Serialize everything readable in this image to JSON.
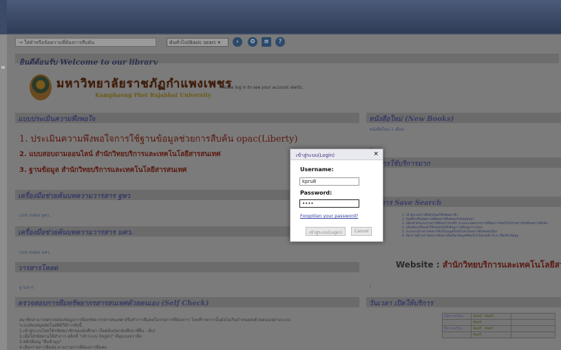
{
  "toolbar": {
    "search_placeholder": "ใส่คำหรือข้อความที่ต้องการสืบค้น",
    "search_type": "ค้นทั่วไป(Basic searc",
    "icons": [
      "go-icon",
      "advanced-search-icon",
      "list-icon",
      "help-icon"
    ]
  },
  "welcome": "ยินดีต้อนรับ Welcome to our library",
  "university": {
    "name_th": "มหาวิทยาลัยราชภัฏกำแพงเพชร",
    "name_en": "Kamphaeng Phet Rajabhat University"
  },
  "login_note": "Please log in to see your account alerts.",
  "left": {
    "survey_title": "แบบประเมินความพึงพอใจ",
    "survey_items": [
      "1. ประเมินความพึงพอใจการใช้ฐานข้อมูลช่วยการสืบค้น opac(Liberty)",
      "2. แบบสอบถามออนไลน์ สำนักวิทยบริการและเทคโนโลยีสารสนเทศ",
      "3. ฐานข้อมูล สำนักวิทยบริการและเทคโนโลยีสารสนเทศ"
    ],
    "tool1_title": "เครื่องมือช่วยค้นบทความวารสาร ฐพว",
    "tool1_link": "Link Index ฐพว.",
    "tool2_title": "เครื่องมือช่วยค้นบทความวารสาร มศว.",
    "tool2_link": "Link Index มศว.",
    "journal_title": "วารสารโหลด",
    "journal_link": "ฐานสาร",
    "selfcheck_title": "ตรวจสอบการยืมทรัพยากรสารสนเทศด้วยตนเอง (Self Check)",
    "selfcheck_lines": [
      "สมาชิกสามารถตรวจสอบข้อมูลการยืมทรัพยากรสารสนเทศ หรือทำการยืมต่อในรายการที่ต้องการ โดยที่รายการนั้นยังไม่เกินกำหนดส่งด้วยตนเองผ่านระบบ",
      "ระบบห้องสมุดอัตโนมัติมีวิธีการดังนี้",
      "1.เข้าสู่ระบบโดยใช้รหัสสมาชิกของนักศึกษา (ล็อคอินบัตรนักศึกษาที่ยื่น - ติ่ม)",
      "2.เมื่อใส่รหัสผ่านให้ทำการ คลิกที่ \"เข้าระบบ (login)\" ที่มุมบนขวามือ",
      "3.คลิกที่เมนู \"ยืมข้ามุน\"",
      "4.เลือกรายการยืมต่อ ตามรายการที่ต้องการยืมต่อ"
    ]
  },
  "right": {
    "new_books_title": "หนังสือใหม่ (New Books)",
    "new_books_sub": "หนังสือใหม่ 1 เดือน",
    "small_link": "+",
    "popular_title": "ที่มีการใช้บริการมาก",
    "popular_sub": "+",
    "save_search_title": "รายการ Save Search",
    "save_search_lines": [
      "1. เข้าสู่ระบบการสืบค้นโดยใช้รหัสสมาชิก",
      "2. พิมพ์คำหรือข้อความที่ต้องการสืบค้นลงในช่องค้นหา",
      "3. เลือกคำค้นและรายการที่ต้องการบันทึก ระบบจะแสดงรายการที่ต้องการจัดเก็บในรายการบันทึกผลการสืบค้น",
      "4. เมื่อเลือกเสร็จแล้วให้กดปุ่มบันทึกข้อมูล ไปที่เมนูการ Save",
      "5. ระบบจะดูรายการผลการค้นในเมนูครั้งถัดไปตามผลการสืบค้นต่อเนื่อง",
      "6. ต้องการดูรายการผลการค้นหาเมื่อเลือกข้อมูลที่จัดเก็บไว้แล้วคลิก Run เพื่อเรียกข้อมูล"
    ],
    "website_prefix": "Website :",
    "website_name": "สำนักวิทยบริการและเทคโนโลยีสารสน",
    "slash": "/",
    "hours_title": "วันเวลา เปิดให้บริการ",
    "hours": [
      {
        "label": "เปิดภาคเรียน",
        "day1": "จันทร์ - จันทร์",
        "day2": "จันทร์"
      },
      {
        "label": "ปิดภาคเรียน",
        "day1": "จันทร์ - จันทร์",
        "day2": "จันทร์"
      }
    ]
  },
  "login": {
    "title": "เข้าสู่ระบบ(Login)",
    "close": "×",
    "username_label": "Username:",
    "username_value": "kpru8",
    "password_label": "Password:",
    "password_value": "••••",
    "forgot": "Forgotten your password?",
    "login_button": "เข้าสู่ระบบ(Login)",
    "cancel_button": "Cancel"
  }
}
